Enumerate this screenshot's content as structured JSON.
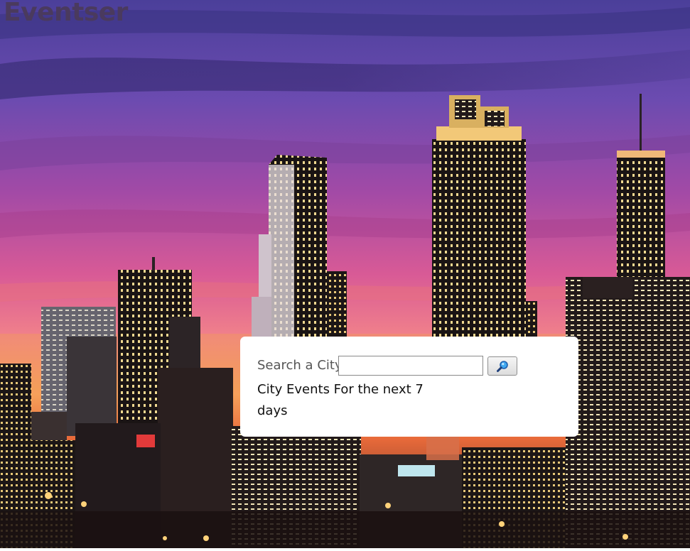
{
  "header": {
    "title": "Eventser"
  },
  "search": {
    "label": "Search a City",
    "input_value": "",
    "placeholder": "",
    "button_icon": "magnifier-icon"
  },
  "events": {
    "heading": "City Events For the next 7 days"
  },
  "colors": {
    "title": "#4a3a5e",
    "card": "#ffffff",
    "sky_top": "#5a4ba8",
    "sky_mid": "#c24c9a",
    "horizon": "#f08a3c"
  },
  "background": {
    "description_icon": "city-skyline-image"
  }
}
